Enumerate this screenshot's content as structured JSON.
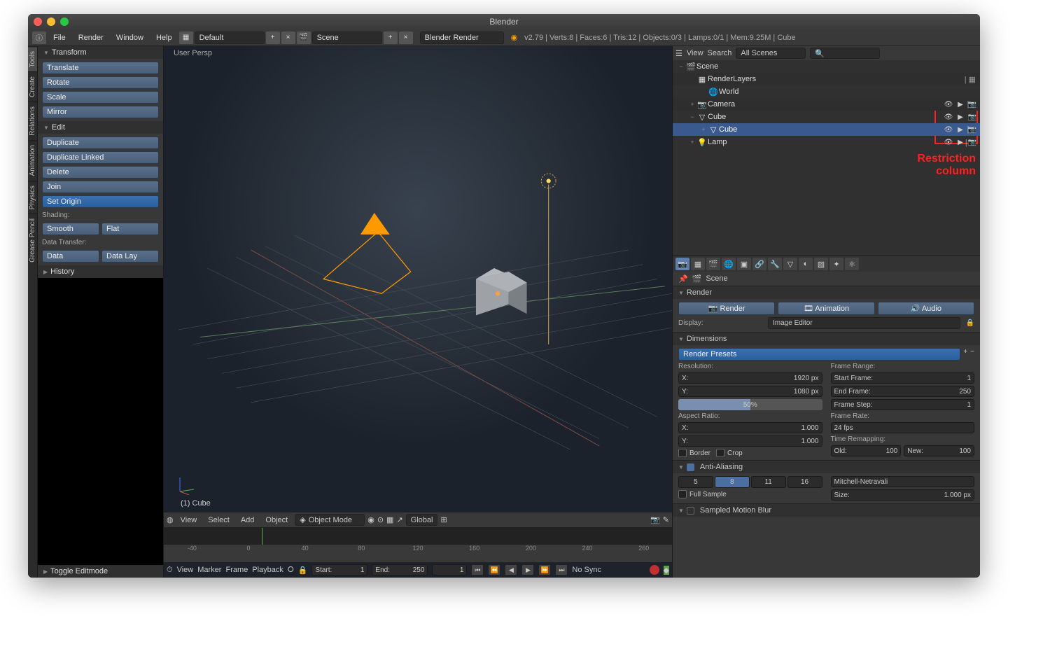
{
  "window_title": "Blender",
  "menubar": {
    "items": [
      "File",
      "Render",
      "Window",
      "Help"
    ],
    "layout_label": "Default",
    "scene_label": "Scene",
    "engine": "Blender Render",
    "stats": "v2.79 | Verts:8 | Faces:6 | Tris:12 | Objects:0/3 | Lamps:0/1 | Mem:9.25M | Cube"
  },
  "viewport": {
    "label": "User Persp",
    "object_footer": "(1) Cube",
    "header_menus": [
      "View",
      "Select",
      "Add",
      "Object"
    ],
    "mode": "Object Mode",
    "orientation": "Global"
  },
  "toolshelf": {
    "tabs": [
      "Tools",
      "Create",
      "Relations",
      "Animation",
      "Physics",
      "Grease Pencil"
    ],
    "active_tab": 0,
    "transform": {
      "title": "Transform",
      "items": [
        "Translate",
        "Rotate",
        "Scale",
        "Mirror"
      ]
    },
    "edit": {
      "title": "Edit",
      "items": [
        "Duplicate",
        "Duplicate Linked",
        "Delete",
        "Join"
      ],
      "set_origin": "Set Origin",
      "shading_label": "Shading:",
      "smooth": "Smooth",
      "flat": "Flat",
      "data_transfer": "Data Transfer:",
      "data": "Data",
      "data_lay": "Data Lay"
    },
    "history": "History",
    "toggle": "Toggle Editmode"
  },
  "outliner": {
    "view": "View",
    "search_label": "Search",
    "filter": "All Scenes",
    "rows": [
      {
        "depth": 0,
        "exp": "−",
        "icon": "🎬",
        "name": "Scene",
        "restrict": false
      },
      {
        "depth": 1,
        "exp": "",
        "icon": "▦",
        "name": "RenderLayers",
        "restrict": false,
        "extra": "▦"
      },
      {
        "depth": 2,
        "exp": "",
        "icon": "🌐",
        "name": "World",
        "restrict": false
      },
      {
        "depth": 1,
        "exp": "+",
        "icon": "📷",
        "name": "Camera",
        "restrict": true,
        "extra": "◐"
      },
      {
        "depth": 1,
        "exp": "−",
        "icon": "▽",
        "name": "Cube",
        "restrict": true
      },
      {
        "depth": 2,
        "exp": "+",
        "icon": "▽",
        "name": "Cube",
        "sel": true,
        "restrict": true,
        "extra": "◐"
      },
      {
        "depth": 1,
        "exp": "+",
        "icon": "💡",
        "name": "Lamp",
        "restrict": true,
        "extra": "✦"
      }
    ],
    "annotation": "Restriction\ncolumn"
  },
  "properties": {
    "context_title": "Scene",
    "render": {
      "title": "Render",
      "btn_render": "Render",
      "btn_anim": "Animation",
      "btn_audio": "Audio",
      "display_label": "Display:",
      "display_val": "Image Editor"
    },
    "dimensions": {
      "title": "Dimensions",
      "presets": "Render Presets",
      "resolution_label": "Resolution:",
      "x_label": "X:",
      "x_val": "1920 px",
      "y_label": "Y:",
      "y_val": "1080 px",
      "scale": "50%",
      "aspect_label": "Aspect Ratio:",
      "ax": "1.000",
      "ay": "1.000",
      "border": "Border",
      "crop": "Crop",
      "frame_range": "Frame Range:",
      "start": "Start Frame:",
      "start_v": "1",
      "end": "End Frame:",
      "end_v": "250",
      "step": "Frame Step:",
      "step_v": "1",
      "frame_rate": "Frame Rate:",
      "fps": "24 fps",
      "remap": "Time Remapping:",
      "old": "Old:",
      "old_v": "100",
      "new": "New:",
      "new_v": "100"
    },
    "aa": {
      "title": "Anti-Aliasing",
      "samples": [
        "5",
        "8",
        "11",
        "16"
      ],
      "sel": 1,
      "filter": "Mitchell-Netravali",
      "full": "Full Sample",
      "size_label": "Size:",
      "size_v": "1.000 px"
    },
    "smblur": "Sampled Motion Blur"
  },
  "timeline": {
    "ticks": [
      "-40",
      "0",
      "40",
      "80",
      "120",
      "160",
      "200",
      "240",
      "260"
    ],
    "menus": [
      "View",
      "Marker",
      "Frame",
      "Playback"
    ],
    "start_label": "Start:",
    "start_v": "1",
    "end_label": "End:",
    "end_v": "250",
    "cur_v": "1",
    "sync": "No Sync"
  }
}
